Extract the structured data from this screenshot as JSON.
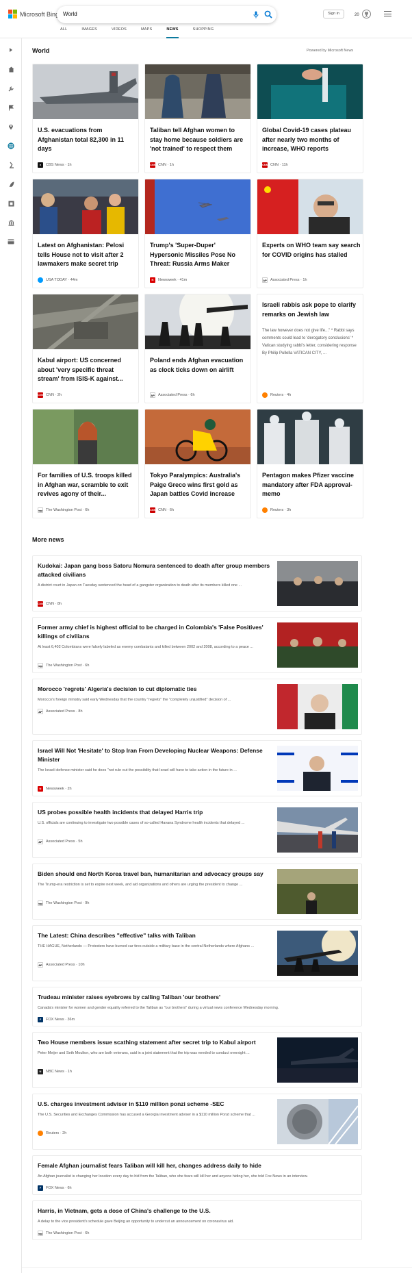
{
  "header": {
    "brand": "Microsoft Bing",
    "search_query": "World",
    "tabs": [
      "ALL",
      "IMAGES",
      "VIDEOS",
      "MAPS",
      "NEWS",
      "SHOPPING"
    ],
    "active_tab": "NEWS",
    "sign_in": "Sign in",
    "rewards_count": "20",
    "colors": {
      "accent": "#0c7a9e",
      "search_icon": "#0078d4"
    }
  },
  "sidebar": {
    "icons": [
      "expand-icon",
      "home-icon",
      "wrench-icon",
      "flag-icon",
      "map-pin-icon",
      "globe-icon",
      "microscope-icon",
      "rocket-icon",
      "film-icon",
      "bank-icon",
      "card-icon"
    ]
  },
  "world": {
    "title": "World",
    "powered_by": "Powered by Microsoft News",
    "cards": [
      {
        "title": "U.S. evacuations from Afghanistan total 82,300 in 11 days",
        "source": "CBS News",
        "time": "1h",
        "logo": "cbs"
      },
      {
        "title": "Taliban tell Afghan women to stay home because soldiers are 'not trained' to respect them",
        "source": "CNN",
        "time": "1h",
        "logo": "cnn"
      },
      {
        "title": "Global Covid-19 cases plateau after nearly two months of increase, WHO reports",
        "source": "CNN",
        "time": "11h",
        "logo": "cnn"
      },
      {
        "title": "Latest on Afghanistan: Pelosi tells House not to visit after 2 lawmakers make secret trip",
        "source": "USA TODAY",
        "time": "44m",
        "logo": "usa"
      },
      {
        "title": "Trump's 'Super-Duper' Hypersonic Missiles Pose No Threat: Russia Arms Maker",
        "source": "Newsweek",
        "time": "41m",
        "logo": "nw"
      },
      {
        "title": "Experts on WHO team say search for COVID origins has stalled",
        "source": "Associated Press",
        "time": "1h",
        "logo": "ap"
      },
      {
        "title": "Kabul airport: US concerned about 'very specific threat stream' from ISIS-K against...",
        "source": "CNN",
        "time": "2h",
        "logo": "cnn"
      },
      {
        "title": "Poland ends Afghan evacuation as clock ticks down on airlift",
        "source": "Associated Press",
        "time": "6h",
        "logo": "ap"
      },
      {
        "title": "Israeli rabbis ask pope to clarify remarks on Jewish law",
        "snippet": "The law however does not give life...\" * Rabbi says comments could lead to 'derogatory conclusions' * Vatican studying rabbi's letter, considering response By Philip Pullella VATICAN CITY, ...",
        "source": "Reuters",
        "time": "4h",
        "logo": "reuters"
      },
      {
        "title": "For families of U.S. troops killed in Afghan war, scramble to exit revives agony of their...",
        "source": "The Washington Post",
        "time": "6h",
        "logo": "wp"
      },
      {
        "title": "Tokyo Paralympics: Australia's Paige Greco wins first gold as Japan battles Covid increase",
        "source": "CNN",
        "time": "6h",
        "logo": "cnn"
      },
      {
        "title": "Pentagon makes Pfizer vaccine mandatory after FDA approval-memo",
        "source": "Reuters",
        "time": "3h",
        "logo": "reuters"
      }
    ]
  },
  "more_news": {
    "title": "More news",
    "items": [
      {
        "title": "Kudokai: Japan gang boss Satoru Nomura sentenced to death after group members attacked civilians",
        "snippet": "A district court in Japan on Tuesday sentenced the head of a gangster organization to death after its members killed one ...",
        "source": "CNN",
        "time": "8h",
        "logo": "cnn"
      },
      {
        "title": "Former army chief is highest official to be charged in Colombia's 'False Positives' killings of civilians",
        "snippet": "At least 6,402 Colombians were falsely labeled as enemy combatants and killed between 2002 and 2008, according to a peace ...",
        "source": "The Washington Post",
        "time": "6h",
        "logo": "wp"
      },
      {
        "title": "Morocco 'regrets' Algeria's decision to cut diplomatic ties",
        "snippet": "Morocco's foreign ministry said early Wednesday that the country \"regrets\" the \"completely unjustified\" decision of ...",
        "source": "Associated Press",
        "time": "8h",
        "logo": "ap"
      },
      {
        "title": "Israel Will Not 'Hesitate' to Stop Iran From Developing Nuclear Weapons: Defense Minister",
        "snippet": "The Israeli defense minister said he does \"not rule out the possibility that Israel will have to take action in the future in ...",
        "source": "Newsweek",
        "time": "2h",
        "logo": "nw"
      },
      {
        "title": "US probes possible health incidents that delayed Harris trip",
        "snippet": "U.S. officials are continuing to investigate two possible cases of so-called Havana Syndrome health incidents that delayed ...",
        "source": "Associated Press",
        "time": "5h",
        "logo": "ap"
      },
      {
        "title": "Biden should end North Korea travel ban, humanitarian and advocacy groups say",
        "snippet": "The Trump-era restriction is set to expire next week, and aid organizations and others are urging the president to change ...",
        "source": "The Washington Post",
        "time": "9h",
        "logo": "wp"
      },
      {
        "title": "The Latest: China describes \"effective\" talks with Taliban",
        "snippet": "THE HAGUE, Netherlands — Protesters have burned car tires outside a military base in the central Netherlands where Afghans ...",
        "source": "Associated Press",
        "time": "10h",
        "logo": "ap"
      },
      {
        "title": "Trudeau minister raises eyebrows by calling Taliban 'our brothers'",
        "snippet": "Canada's minister for women and gender equality referred to the Taliban as \"our brothers\" during a virtual news conference Wednesday morning.",
        "source": "FOX News",
        "time": "36m",
        "logo": "fox"
      },
      {
        "title": "Two House members issue scathing statement after secret trip to Kabul airport",
        "snippet": "Peter Meijer and Seth Moulton, who are both veterans, said in a joint statement that the trip was needed to conduct oversight ...",
        "source": "NBC News",
        "time": "1h",
        "logo": "nbc"
      },
      {
        "title": "U.S. charges investment adviser in $110 million ponzi scheme -SEC",
        "snippet": "The U.S. Securities and Exchanges Commission has accused a Georgia investment adviser in a $110 million Ponzi scheme that ...",
        "source": "Reuters",
        "time": "2h",
        "logo": "reuters"
      },
      {
        "title": "Female Afghan journalist fears Taliban will kill her, changes address daily to hide",
        "snippet": "An Afghan journalist is changing her location every day to hid from the Taliban, who she fears will kill her and anyone hiding her, she told Fox News in an interview.",
        "source": "FOX News",
        "time": "6h",
        "logo": "fox"
      },
      {
        "title": "Harris, in Vietnam, gets a dose of China's challenge to the U.S.",
        "snippet": "A delay to the vice president's schedule gave Beijing an opportunity to undercut an announcement on coronavirus aid.",
        "source": "The Washington Post",
        "time": "6h",
        "logo": "wp"
      }
    ]
  }
}
